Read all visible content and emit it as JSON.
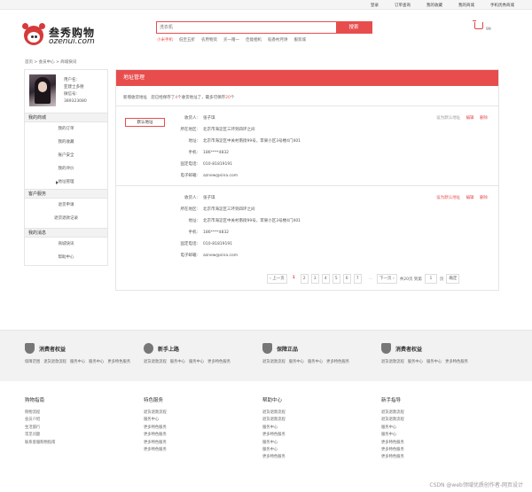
{
  "topbar": {
    "links": [
      "登录",
      "订单查询",
      "我的收藏",
      "我的商城",
      "手机优秀商城"
    ]
  },
  "logo": {
    "cn": "叁秀购物",
    "en": "ozenui.com"
  },
  "search": {
    "placeholder": "洗衣机",
    "button": "搜索",
    "hot": [
      "小米手机",
      "低至五折",
      "农用物资",
      "买一赠一",
      "佳能相机",
      "稻香村月饼",
      "服装城"
    ]
  },
  "cart": {
    "count": "99"
  },
  "breadcrumb": "首页 > 会员中心 > 商城快讯",
  "user": {
    "name_label": "用户名:",
    "name": "亚建士多德",
    "account_label": "微信号:",
    "account": "389323080"
  },
  "sidebar": [
    {
      "head": "我的商城",
      "items": [
        "我的订单",
        "我的收藏",
        "账户安全",
        "我的评价",
        "地址管理"
      ],
      "active": 4
    },
    {
      "head": "客户服务",
      "items": [
        "退货申请",
        "退货退款记录"
      ],
      "active": -1
    },
    {
      "head": "我的消息",
      "items": [
        "商城快讯",
        "帮助中心"
      ],
      "active": -1
    }
  ],
  "main": {
    "title": "地址管理",
    "tip_prefix": "新增收货地址",
    "tip_mid": "您已经保存了",
    "tip_count": "4",
    "tip_suffix": "个收货地址了，最多可保存",
    "tip_max": "20",
    "tip_end": "个",
    "labels": [
      "收货人:",
      "所在地区:",
      "地址:",
      "手机:",
      "固定电话:",
      "电子邮箱:"
    ],
    "addresses": [
      {
        "default_btn": "默认地址",
        "name": "张子琪",
        "region": "北京市海淀区三环到四环之间",
        "address": "北京市海淀区中关村南街99号，苹果小区3号楼4门401",
        "mobile": "186****4832",
        "phone": "010-81819191",
        "email": "aznew@sina.com",
        "ops": [
          "设为默认地址",
          "编辑",
          "删除"
        ]
      },
      {
        "name": "张子琪",
        "region": "北京市海淀区三环到四环之间",
        "address": "北京市海淀区中关村南街99号，苹果小区3号楼4门401",
        "mobile": "186****4832",
        "phone": "010-81819191",
        "email": "aznew@sina.com",
        "ops": [
          "设为默认地址",
          "编辑",
          "删除"
        ]
      }
    ],
    "pager": {
      "prev": "上一页",
      "current": "1",
      "pages": [
        "2",
        "3",
        "4",
        "5",
        "6",
        "7"
      ],
      "dots": "...",
      "next": "下一页",
      "total": "共20页 到第",
      "page_input": "1",
      "unit": "页",
      "confirm": "确定"
    }
  },
  "services": [
    {
      "title": "消费者权益",
      "links": [
        "保障范围",
        "退货退款流程",
        "服务中心",
        "更多特色服务"
      ]
    },
    {
      "title": "新手上路",
      "links": [
        "退货退款流程",
        "服务中心",
        "服务中心",
        "更多特色服务"
      ]
    },
    {
      "title": "保障正品",
      "links": [
        "退货退款流程",
        "服务中心",
        "服务中心",
        "更多特色服务"
      ]
    },
    {
      "title": "消费者权益",
      "links": [
        "退货退款流程",
        "服务中心",
        "服务中心",
        "更多特色服务"
      ]
    }
  ],
  "footer": [
    {
      "title": "购物指南",
      "links": [
        "购物流程",
        "会员介绍",
        "生活旅行",
        "常见问题",
        "联系客服购物指南"
      ]
    },
    {
      "title": "特色服务",
      "links": [
        "退货退款流程",
        "服务中心",
        "更多特色服务",
        "更多特色服务",
        "更多特色服务",
        "更多特色服务"
      ]
    },
    {
      "title": "帮助中心",
      "links": [
        "退货退款流程",
        "退货退款流程",
        "服务中心",
        "更多特色服务",
        "服务中心",
        "服务中心",
        "更多特色服务"
      ]
    },
    {
      "title": "新手指导",
      "links": [
        "退货退款流程",
        "退货退款流程",
        "服务中心",
        "服务中心",
        "更多特色服务",
        "更多特色服务",
        "更多特色服务"
      ]
    }
  ],
  "watermark": "CSDN @web领域优质创作者-网页设计"
}
